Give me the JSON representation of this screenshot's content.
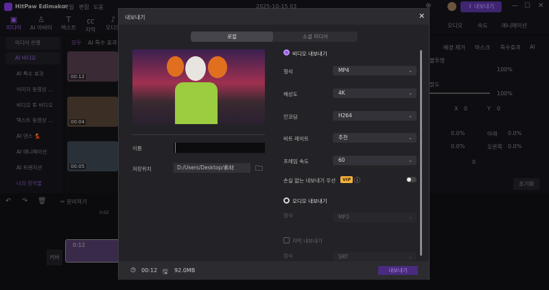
{
  "app": {
    "name": "HitPaw Edimakor",
    "menu": [
      "파일",
      "편집",
      "도움"
    ],
    "date": "2025-10-15 03",
    "export_button": "내보내기"
  },
  "toolbar": [
    "미디어",
    "AI 아바타",
    "텍스트",
    "자막",
    "오디오"
  ],
  "sidebar": {
    "items": [
      "미디어 은행",
      "AI 비디오",
      "AI 특수 효과",
      "이미지 동영상 ...",
      "비디오 투 비디오",
      "텍스트 동영상 ...",
      "AI 댄스 💃",
      "AI 애니메이션",
      "AI 트랜지션",
      "나의 창작물"
    ]
  },
  "media": {
    "tabs": [
      "모두",
      "AI 특수 효과"
    ],
    "thumbs": [
      "00:12",
      "00:04",
      "00:05"
    ]
  },
  "right_panel": {
    "tabs": [
      "오디오",
      "속도",
      "애니메이션"
    ],
    "subtabs": [
      "배경 제거",
      "마스크",
      "특수효과",
      "AI"
    ],
    "labels": [
      "불투명",
      "밝도"
    ],
    "values": [
      "100%",
      "100%"
    ],
    "x_label": "X",
    "x_val": "0",
    "y_label": "Y",
    "y_val": "0",
    "bottom_label": "아래",
    "right_label": "오른쪽",
    "pct": [
      "0.0%",
      "0.0%",
      "0.0%",
      "0.0%"
    ],
    "rotate": "0",
    "reset": "초기화"
  },
  "timeline": {
    "split": "분리하기",
    "time": "0:02",
    "track_label": "커버",
    "clip_duration": "0:12"
  },
  "dialog": {
    "title": "내보내기",
    "tabs": [
      "로컬",
      "소셜 미디어"
    ],
    "name_label": "이름",
    "name_value": "",
    "save_label": "저장위치",
    "save_path": "D:/Users/Desktop/素材",
    "video_export": "비디오 내보내기",
    "fields": [
      {
        "label": "형식",
        "value": "MP4"
      },
      {
        "label": "해상도",
        "value": "4K"
      },
      {
        "label": "인코딩",
        "value": "H264"
      },
      {
        "label": "비트 레이트",
        "value": "추천"
      },
      {
        "label": "프레임 속도",
        "value": "60"
      }
    ],
    "lossless": "손실 없는 내보내기 우선",
    "vip": "VIP",
    "audio_export": "오디오 내보내기",
    "audio_format_label": "형식",
    "audio_format": "MP3",
    "subtitle_export": "자막 내보내기",
    "subtitle_format_label": "형식",
    "subtitle_format": "SRT",
    "duration": "00:12",
    "size": "92.0MB",
    "export": "내보내기"
  },
  "colors": {
    "accent": "#7b3fd6",
    "vip": "#f5b13a"
  }
}
